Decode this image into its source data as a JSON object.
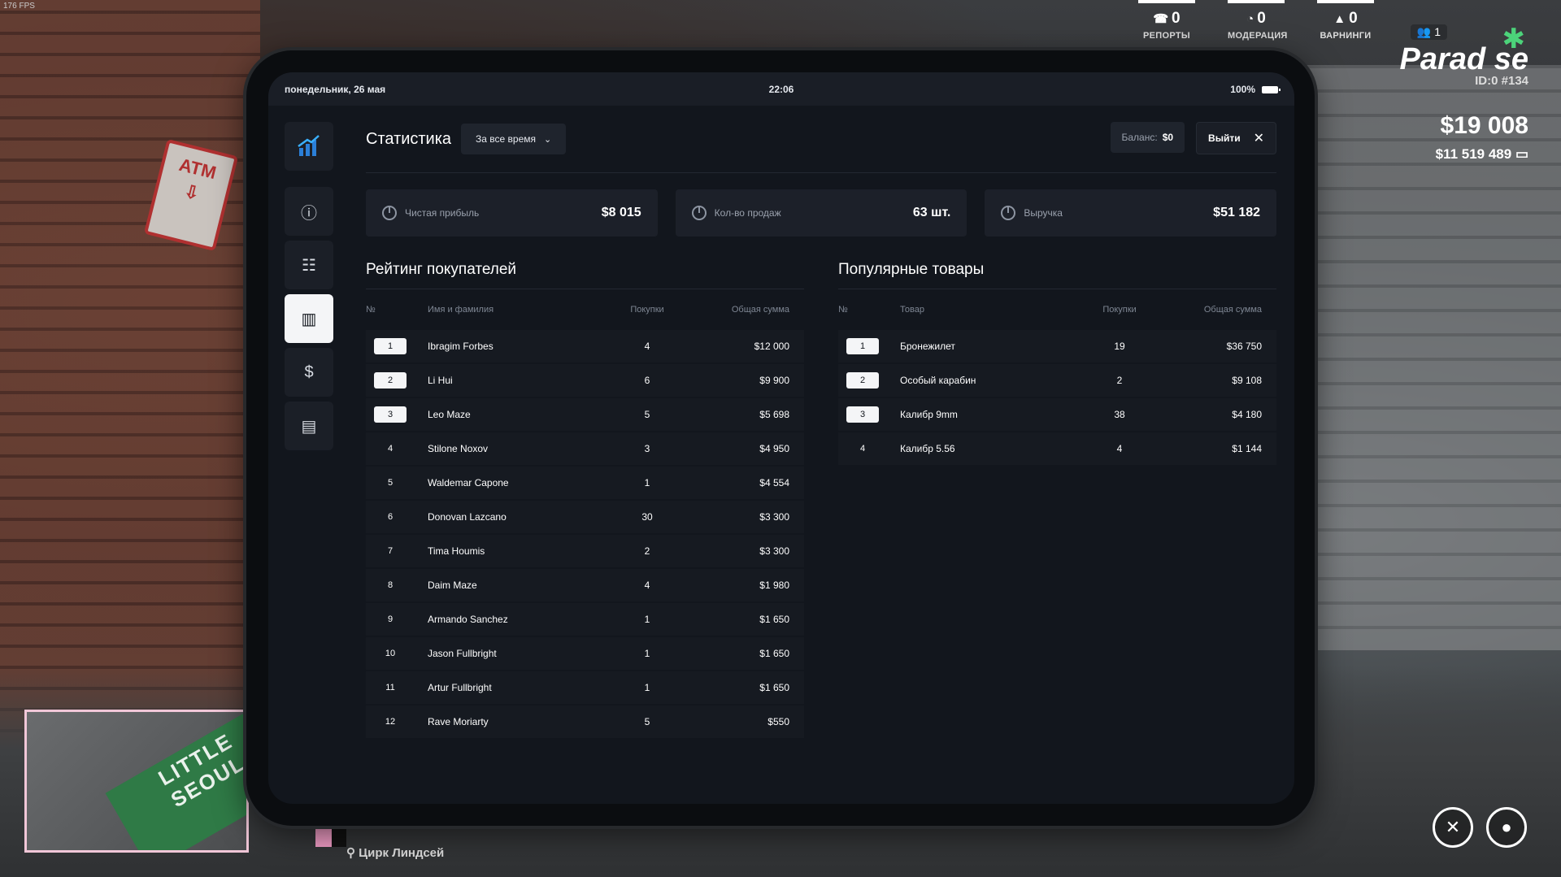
{
  "fps": "176 FPS",
  "hud": {
    "stats": [
      {
        "icon": "reports-icon",
        "value": "0",
        "label": "РЕПОРТЫ"
      },
      {
        "icon": "moderation-icon",
        "value": "0",
        "label": "МОДЕРАЦИЯ"
      },
      {
        "icon": "warning-icon",
        "value": "0",
        "label": "ВАРНИНГИ"
      }
    ],
    "online": "1",
    "logo": "Parad se",
    "player_id": "ID:0 #134",
    "cash": "$19 008",
    "bank": "$11 519 489"
  },
  "map": {
    "area_label": "LITTLE SEOUL",
    "location": "Цирк Линдсей"
  },
  "tablet": {
    "status": {
      "date": "понедельник, 26 мая",
      "time": "22:06",
      "battery": "100%"
    },
    "title": "Статистика",
    "period": "За все время",
    "balance_label": "Баланс:",
    "balance_value": "$0",
    "exit_label": "Выйти",
    "cards": [
      {
        "label": "Чистая прибыль",
        "value": "$8 015"
      },
      {
        "label": "Кол-во продаж",
        "value": "63 шт."
      },
      {
        "label": "Выручка",
        "value": "$51 182"
      }
    ],
    "buyers": {
      "title": "Рейтинг покупателей",
      "columns": [
        "№",
        "Имя и фамилия",
        "Покупки",
        "Общая сумма"
      ],
      "rows": [
        {
          "n": "1",
          "name": "Ibragim Forbes",
          "buys": "4",
          "sum": "$12 000"
        },
        {
          "n": "2",
          "name": "Li Hui",
          "buys": "6",
          "sum": "$9 900"
        },
        {
          "n": "3",
          "name": "Leo Maze",
          "buys": "5",
          "sum": "$5 698"
        },
        {
          "n": "4",
          "name": "Stilone Noxov",
          "buys": "3",
          "sum": "$4 950"
        },
        {
          "n": "5",
          "name": "Waldemar Capone",
          "buys": "1",
          "sum": "$4 554"
        },
        {
          "n": "6",
          "name": "Donovan Lazcano",
          "buys": "30",
          "sum": "$3 300"
        },
        {
          "n": "7",
          "name": "Tima Houmis",
          "buys": "2",
          "sum": "$3 300"
        },
        {
          "n": "8",
          "name": "Daim Maze",
          "buys": "4",
          "sum": "$1 980"
        },
        {
          "n": "9",
          "name": "Armando Sanchez",
          "buys": "1",
          "sum": "$1 650"
        },
        {
          "n": "10",
          "name": "Jason Fullbright",
          "buys": "1",
          "sum": "$1 650"
        },
        {
          "n": "11",
          "name": "Artur Fullbright",
          "buys": "1",
          "sum": "$1 650"
        },
        {
          "n": "12",
          "name": "Rave Moriarty",
          "buys": "5",
          "sum": "$550"
        }
      ]
    },
    "products": {
      "title": "Популярные товары",
      "columns": [
        "№",
        "Товар",
        "Покупки",
        "Общая сумма"
      ],
      "rows": [
        {
          "n": "1",
          "name": "Бронежилет",
          "buys": "19",
          "sum": "$36 750"
        },
        {
          "n": "2",
          "name": "Особый карабин",
          "buys": "2",
          "sum": "$9 108"
        },
        {
          "n": "3",
          "name": "Калибр 9mm",
          "buys": "38",
          "sum": "$4 180"
        },
        {
          "n": "4",
          "name": "Калибр 5.56",
          "buys": "4",
          "sum": "$1 144"
        }
      ]
    }
  }
}
